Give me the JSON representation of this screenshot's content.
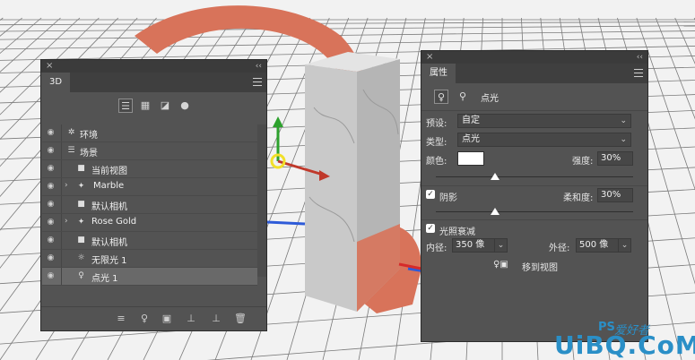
{
  "panel3d": {
    "tab_label": "3D",
    "close_glyph": "×",
    "collapse_glyph": "‹‹",
    "filter_icons": [
      "whole-scene-icon",
      "meshes-icon",
      "materials-icon",
      "lights-icon"
    ],
    "layers": [
      {
        "label": "环境",
        "icon": "environment-icon",
        "expander": false,
        "selected": false
      },
      {
        "label": "场景",
        "icon": "scene-icon",
        "expander": false,
        "selected": false
      },
      {
        "label": "当前视图",
        "icon": "camera-icon",
        "expander": false,
        "selected": false
      },
      {
        "label": "Marble",
        "icon": "mesh-icon",
        "expander": true,
        "selected": false
      },
      {
        "label": "默认相机",
        "icon": "camera-icon",
        "expander": false,
        "selected": false
      },
      {
        "label": "Rose Gold",
        "icon": "mesh-icon",
        "expander": true,
        "selected": false
      },
      {
        "label": "默认相机",
        "icon": "camera-icon",
        "expander": false,
        "selected": false
      },
      {
        "label": "无限光 1",
        "icon": "infinite-light-icon",
        "expander": false,
        "selected": false
      },
      {
        "label": "点光 1",
        "icon": "point-light-icon",
        "expander": false,
        "selected": true
      }
    ],
    "footer_icons": [
      "render-icon",
      "add-light-icon",
      "new-mesh-icon",
      "ground-icon",
      "transform-icon",
      "trash-icon"
    ]
  },
  "properties": {
    "tab_label": "属性",
    "type_label": "点光",
    "preset_label": "预设:",
    "preset_value": "自定",
    "type_row_label": "类型:",
    "type_value": "点光",
    "color_label": "颜色:",
    "color_value": "#ffffff",
    "intensity_label": "强度:",
    "intensity_value": "30%",
    "intensity_pct": 0.3,
    "shadow_label": "阴影",
    "shadow_checked": true,
    "softness_label": "柔和度:",
    "softness_value": "30%",
    "softness_pct": 0.3,
    "falloff_label": "光照衰减",
    "falloff_checked": true,
    "inner_label": "内径:",
    "inner_value": "350 像",
    "outer_label": "外径:",
    "outer_value": "500 像",
    "move_to_view_label": "移到视图"
  },
  "watermark": {
    "main": "UiBQ.CoM",
    "ps": "PS",
    "cn": "爱好者"
  },
  "colors": {
    "panel_bg": "#535353",
    "accent_copper": "#d8735a",
    "watermark_blue": "#2a8fc7"
  }
}
